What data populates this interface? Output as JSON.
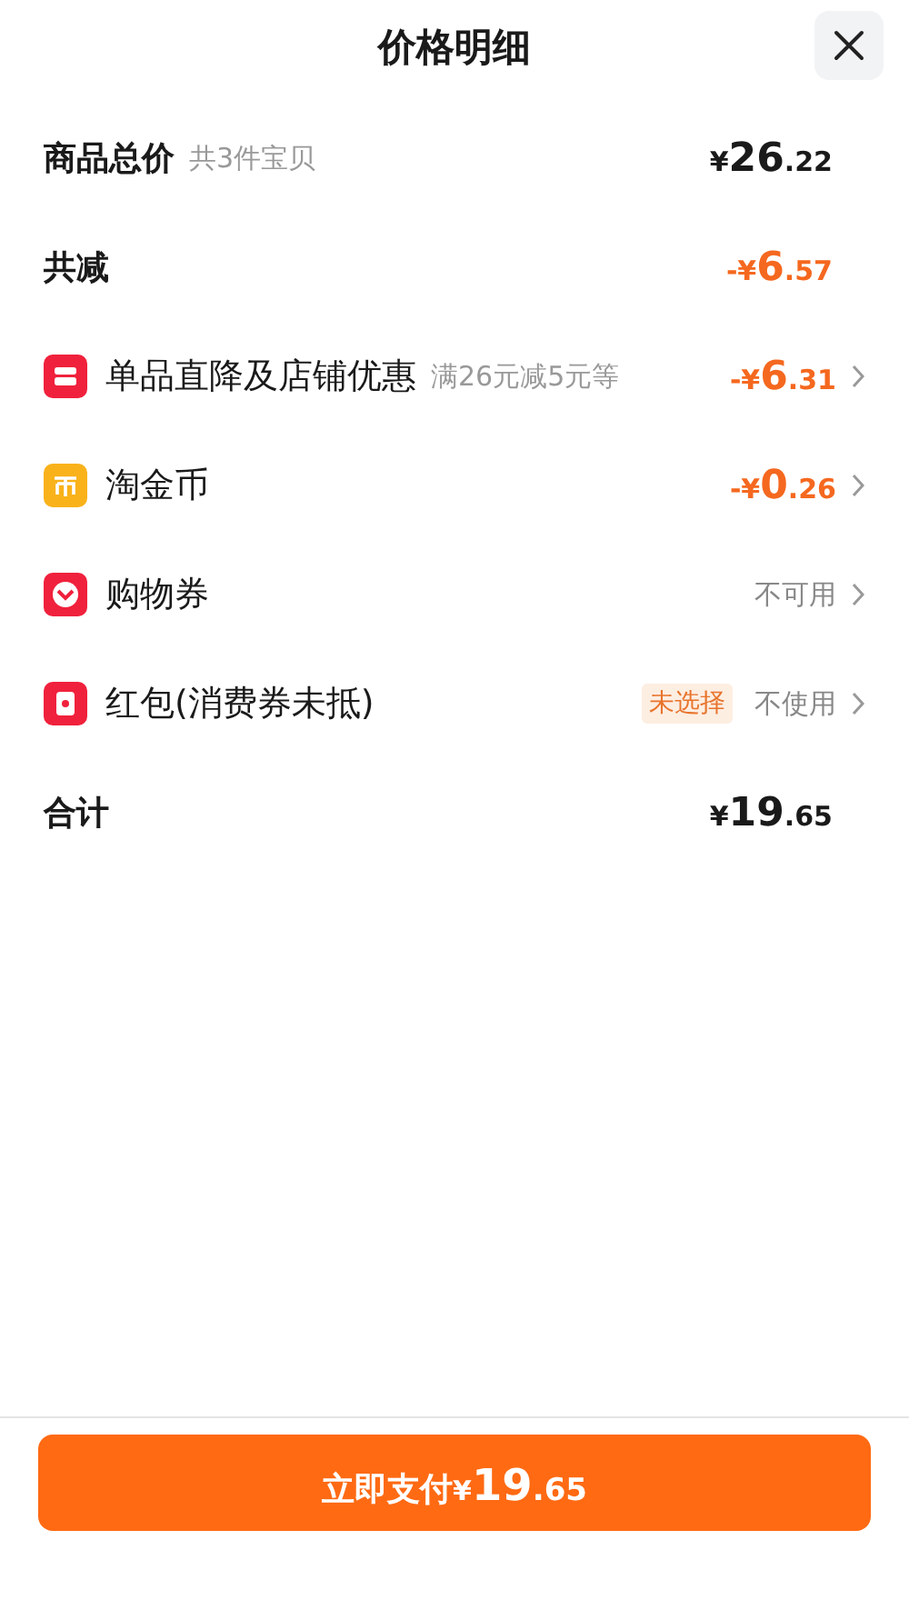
{
  "title": "价格明细",
  "rows": [
    {
      "kind": "total",
      "label": "商品总价",
      "note": "共3件宝贝",
      "value": "¥26.22",
      "highlight": false,
      "link": false
    },
    {
      "kind": "reduction",
      "label": "共减",
      "value": "-¥6.57",
      "highlight": true,
      "link": false
    },
    {
      "kind": "item",
      "label": "单品直降及店铺优惠",
      "note": "满26元减5元等",
      "value": "-¥6.31",
      "highlight": true,
      "link": true
    },
    {
      "kind": "item",
      "label": "淘金币",
      "value": "-¥0.26",
      "highlight": true,
      "link": true
    },
    {
      "kind": "item",
      "label": "购物券",
      "value": "不可用",
      "highlight": false,
      "link": true
    },
    {
      "kind": "item",
      "label": "红包(消费券未抵)",
      "tag": "未选择",
      "value": "不使用",
      "highlight": false,
      "link": true
    },
    {
      "kind": "total",
      "label": "合计",
      "value": "¥19.65",
      "highlight": false,
      "link": false
    }
  ],
  "pay_button": {
    "label": "立即支付",
    "amount": "¥19.65"
  }
}
